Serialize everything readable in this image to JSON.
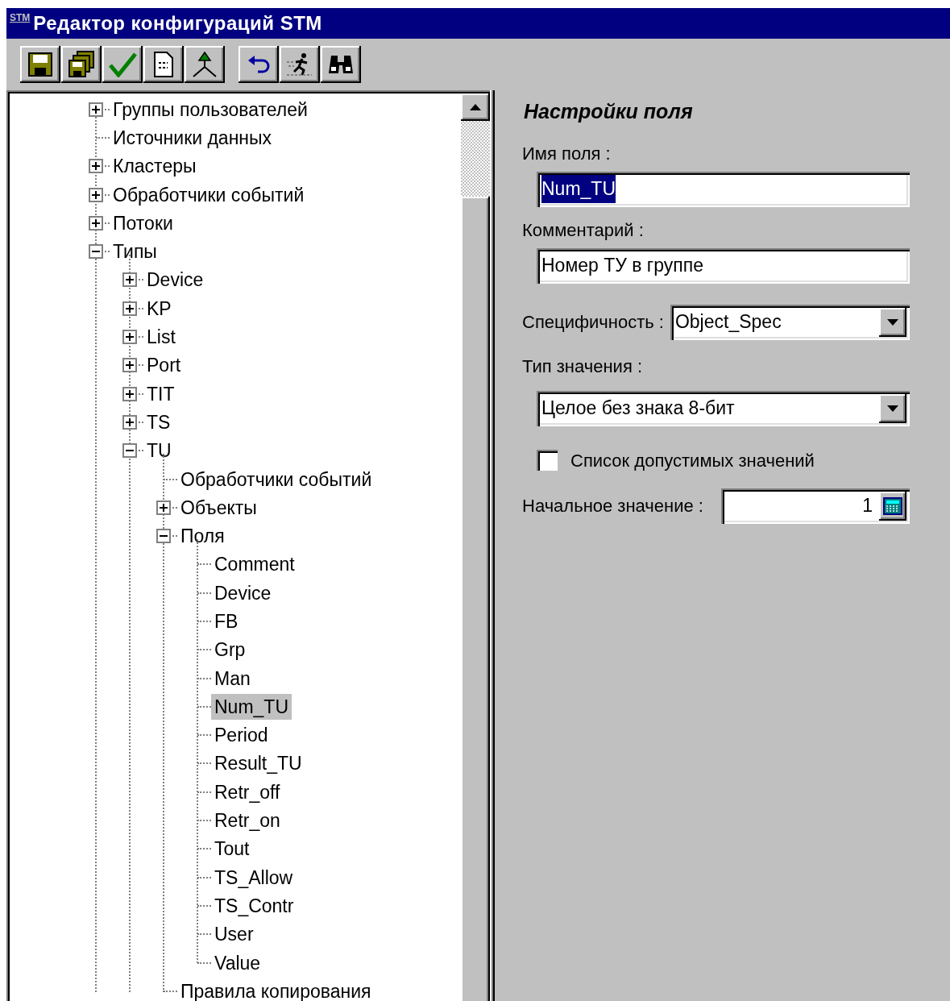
{
  "window": {
    "app_icon_text": "STM",
    "title": "Редактор конфигураций STM"
  },
  "tree": [
    {
      "label": "Группы пользователей",
      "expanded": false,
      "selected": false
    },
    {
      "label": "Источники данных",
      "selected": false
    },
    {
      "label": "Кластеры",
      "expanded": false,
      "selected": false
    },
    {
      "label": "Обработчики событий",
      "expanded": false,
      "selected": false
    },
    {
      "label": "Потоки",
      "expanded": false,
      "selected": false
    },
    {
      "label": "Типы",
      "expanded": true,
      "selected": false,
      "children": [
        {
          "label": "Device",
          "expanded": false,
          "selected": false
        },
        {
          "label": "KP",
          "expanded": false,
          "selected": false
        },
        {
          "label": "List",
          "expanded": false,
          "selected": false
        },
        {
          "label": "Port",
          "expanded": false,
          "selected": false
        },
        {
          "label": "TIT",
          "expanded": false,
          "selected": false
        },
        {
          "label": "TS",
          "expanded": false,
          "selected": false
        },
        {
          "label": "TU",
          "expanded": true,
          "selected": false,
          "children": [
            {
              "label": "Обработчики событий",
              "selected": false
            },
            {
              "label": "Объекты",
              "expanded": false,
              "selected": false
            },
            {
              "label": "Поля",
              "expanded": true,
              "selected": false,
              "children": [
                {
                  "label": "Comment",
                  "selected": false
                },
                {
                  "label": "Device",
                  "selected": false
                },
                {
                  "label": "FB",
                  "selected": false
                },
                {
                  "label": "Grp",
                  "selected": false
                },
                {
                  "label": "Man",
                  "selected": false
                },
                {
                  "label": "Num_TU",
                  "selected": true
                },
                {
                  "label": "Period",
                  "selected": false
                },
                {
                  "label": "Result_TU",
                  "selected": false
                },
                {
                  "label": "Retr_off",
                  "selected": false
                },
                {
                  "label": "Retr_on",
                  "selected": false
                },
                {
                  "label": "Tout",
                  "selected": false
                },
                {
                  "label": "TS_Allow",
                  "selected": false
                },
                {
                  "label": "TS_Contr",
                  "selected": false
                },
                {
                  "label": "User",
                  "selected": false
                },
                {
                  "label": "Value",
                  "selected": false
                }
              ]
            },
            {
              "label": "Правила копирования",
              "selected": false
            }
          ]
        }
      ]
    }
  ],
  "settings": {
    "title": "Настройки поля",
    "field_name": {
      "label": "Имя поля :",
      "value": "Num_TU",
      "text_selected": true
    },
    "comment": {
      "label": "Комментарий :",
      "value": "Номер ТУ в группе"
    },
    "specificity": {
      "label": "Специфичность :",
      "value": "Object_Spec"
    },
    "value_type": {
      "label": "Тип значения :",
      "value": "Целое без знака 8-бит"
    },
    "allowed_values": {
      "label": "Список допустимых значений",
      "checked": false
    },
    "initial_value": {
      "label": "Начальное значение :",
      "value": "1"
    }
  }
}
